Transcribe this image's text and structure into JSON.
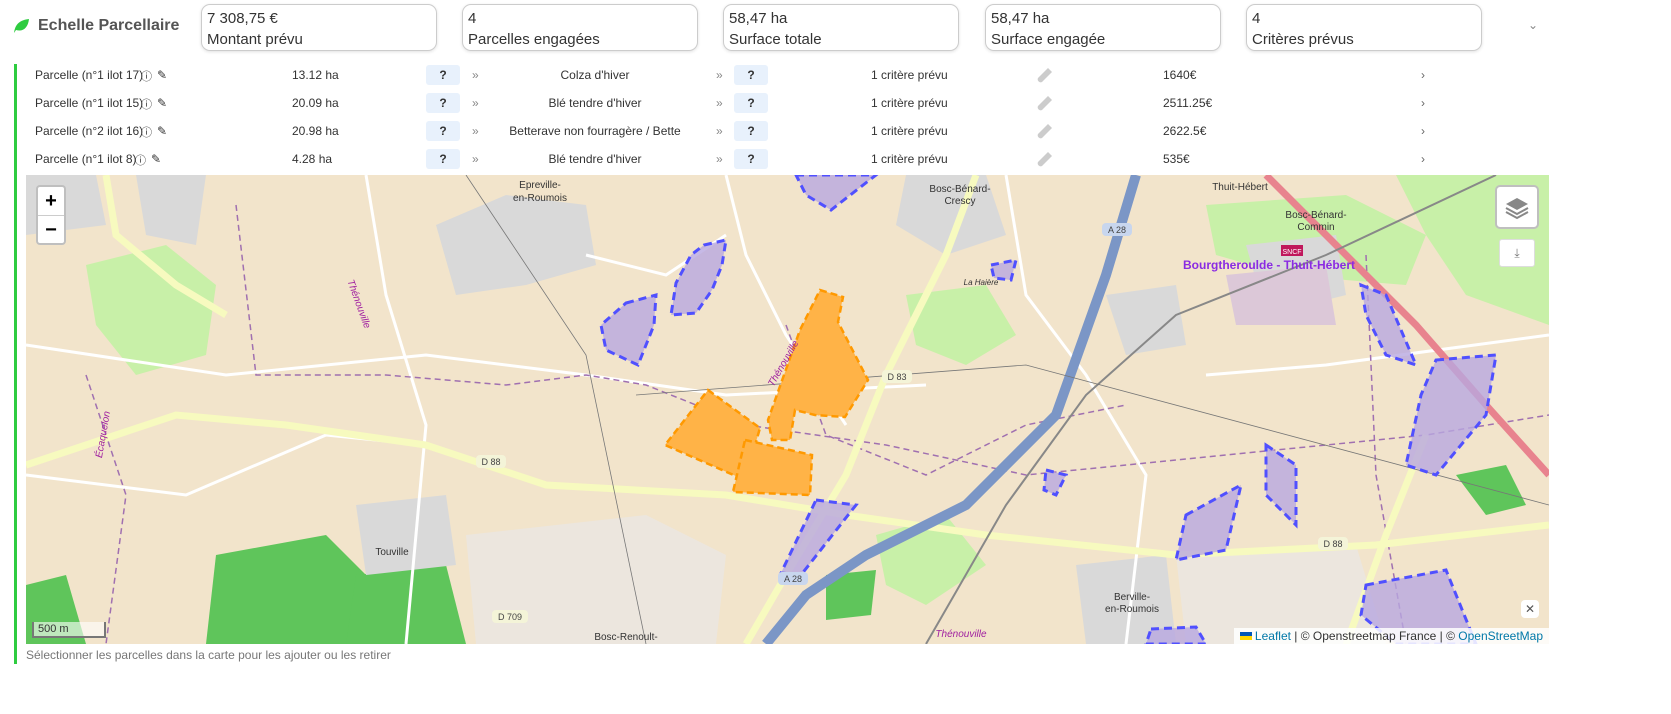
{
  "header": {
    "title": "Echelle Parcellaire",
    "icon": "leaf-icon",
    "accent": "#2ecc40"
  },
  "stats": [
    {
      "value": "7 308,75 €",
      "label": "Montant prévu"
    },
    {
      "value": "4",
      "label": "Parcelles engagées"
    },
    {
      "value": "58,47 ha",
      "label": "Surface totale"
    },
    {
      "value": "58,47 ha",
      "label": "Surface engagée"
    },
    {
      "value": "4",
      "label": "Critères prévus"
    }
  ],
  "parcels": [
    {
      "name": "Parcelle (n°1 ilot 17)",
      "area": "13.12 ha",
      "q1": "?",
      "crop": "Colza d'hiver",
      "q2": "?",
      "criteria": "1 critère prévu",
      "amount": "1640€"
    },
    {
      "name": "Parcelle (n°1 ilot 15)",
      "area": "20.09 ha",
      "q1": "?",
      "crop": "Blé tendre d'hiver",
      "q2": "?",
      "criteria": "1 critère prévu",
      "amount": "2511.25€"
    },
    {
      "name": "Parcelle (n°2 ilot 16)",
      "area": "20.98 ha",
      "q1": "?",
      "crop": "Betterave non fourragère / Bette",
      "q2": "?",
      "criteria": "1 critère prévu",
      "amount": "2622.5€"
    },
    {
      "name": "Parcelle (n°1 ilot 8)",
      "area": "4.28 ha",
      "q1": "?",
      "crop": "Blé tendre d'hiver",
      "q2": "?",
      "criteria": "1 critère prévu",
      "amount": "535€"
    }
  ],
  "map": {
    "zoom_in": "+",
    "zoom_out": "−",
    "scale": "500 m",
    "labels": {
      "epreville": "Epreville-",
      "epreville2": "en-Roumois",
      "bosc": "Bosc-Bénard-",
      "bosc2": "Crescy",
      "thuit": "Thuit-Hébert",
      "commin": "Bosc-Bénard-",
      "commin2": "Commin",
      "station": "Bourgtheroulde - Thuit-Hébert",
      "haiere": "La Haière",
      "thenouville": "Thénouville",
      "ecaquelon": "Écaquelon",
      "touville": "Touville",
      "berville": "Berville-",
      "berville2": "en-Roumois",
      "boscrenoult": "Bosc-Renoult-",
      "a28": "A 28",
      "d83": "D 83",
      "d88": "D 88",
      "d88b": "D 88",
      "d709": "D 709",
      "a28b": "A 28",
      "sncf": "SNCF"
    },
    "attribution": {
      "leaflet": "Leaflet",
      "sep1": " | © Openstreetmap France | © ",
      "osm": "OpenStreetMap"
    },
    "selected_color": "#ffa500",
    "other_color": "#5050ff"
  },
  "hint": "Sélectionner les parcelles dans la carte pour les ajouter ou les retirer"
}
